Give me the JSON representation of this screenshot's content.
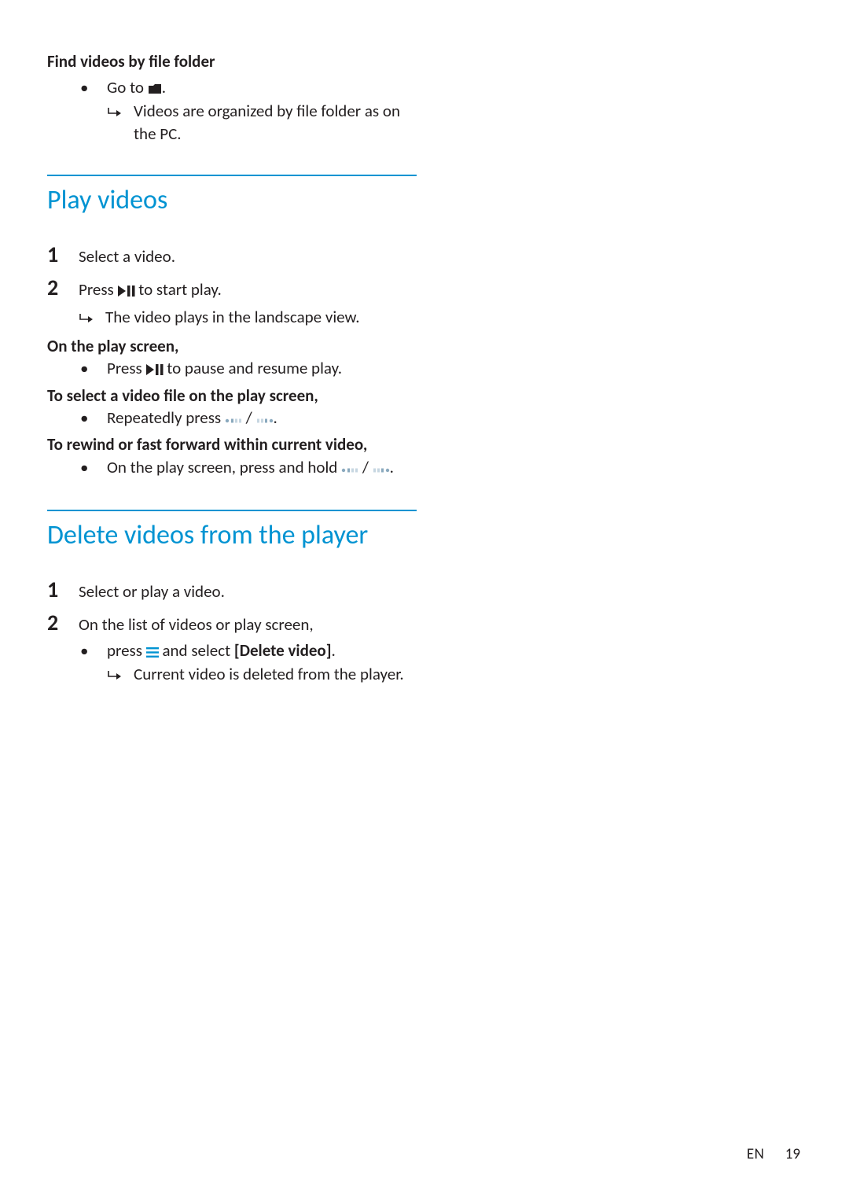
{
  "intro": {
    "heading": "Find videos by file folder",
    "bullet": {
      "pre": "Go to ",
      "post": "."
    },
    "result": "Videos are organized by file folder as on the PC."
  },
  "section1": {
    "title": "Play videos",
    "steps": [
      {
        "num": "1",
        "text": "Select a video."
      },
      {
        "num": "2",
        "pre": "Press ",
        "post": " to start play.",
        "result": "The video plays in the landscape view."
      }
    ],
    "on_play_screen": "On the play screen,",
    "on_play_bullet": {
      "pre": "Press ",
      "post": " to pause and resume play."
    },
    "select_file": "To select a video file on the play screen,",
    "select_file_bullet": {
      "pre": "Repeatedly press ",
      "mid": " / ",
      "post": "."
    },
    "rewind": "To rewind or fast forward within current video,",
    "rewind_bullet": {
      "pre": "On the play screen, press and hold ",
      "mid": " / ",
      "post": "."
    }
  },
  "section2": {
    "title": "Delete videos from the player",
    "steps": [
      {
        "num": "1",
        "text": "Select or play a video."
      },
      {
        "num": "2",
        "text": "On the list of videos or play screen,"
      }
    ],
    "bullet": {
      "pre": "press ",
      "mid": " and select ",
      "option": "[Delete video]",
      "post": "."
    },
    "result": "Current video is deleted from the player."
  },
  "footer": {
    "lang": "EN",
    "page": "19"
  }
}
